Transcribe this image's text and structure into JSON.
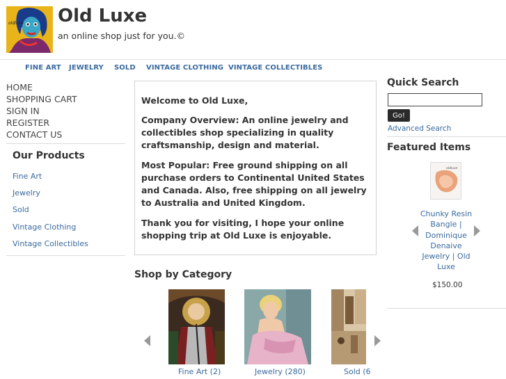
{
  "header": {
    "title": "Old Luxe",
    "tagline": "an online shop just for you.©",
    "logo_icon": "pop-art-woman-portrait-icon"
  },
  "nav": {
    "items": [
      "FINE ART",
      "JEWELRY",
      "SOLD",
      "VINTAGE CLOTHING",
      "VINTAGE COLLECTIBLES"
    ]
  },
  "left_menu": {
    "items": [
      "HOME",
      "SHOPPING CART",
      "SIGN IN",
      "REGISTER",
      "CONTACT US"
    ]
  },
  "products": {
    "heading": "Our Products",
    "categories": [
      "Fine Art",
      "Jewelry",
      "Sold",
      "Vintage Clothing",
      "Vintage Collectibles"
    ]
  },
  "welcome": {
    "greeting": "Welcome to Old Luxe,",
    "overview": "Company Overview: An online jewelry and collectibles shop specializing in quality craftsmanship, design and material.",
    "popular": "Most Popular: Free ground shipping on all purchase orders to Continental United States and Canada. Also, free shipping on all jewelry to Australia and United Kingdom.",
    "thanks": "Thank you for visiting, I hope your online shopping trip at Old Luxe is enjoyable."
  },
  "shop_by_category": {
    "heading": "Shop by Category",
    "items": [
      {
        "caption": "Fine Art (2)",
        "image": "stained-glass-saint-painting"
      },
      {
        "caption": "Jewelry (280)",
        "image": "vintage-woman-pink-dress-portrait"
      },
      {
        "caption": "Sold (6",
        "image": "market-street-scene"
      }
    ],
    "prev_icon": "chevron-left-icon",
    "next_icon": "chevron-right-icon"
  },
  "quick_search": {
    "heading": "Quick Search",
    "input_value": "",
    "go_label": "Go!",
    "advanced_label": "Advanced Search"
  },
  "featured": {
    "heading": "Featured Items",
    "item_name": "Chunky Resin Bangle | Dominique Denaive Jewelry | Old Luxe",
    "price": "$150.00",
    "image": "orange-resin-bangle-photo"
  },
  "colors": {
    "link": "#3a6a9e",
    "text": "#333333",
    "divider": "#dcdcdc",
    "button": "#2a2a2a"
  }
}
